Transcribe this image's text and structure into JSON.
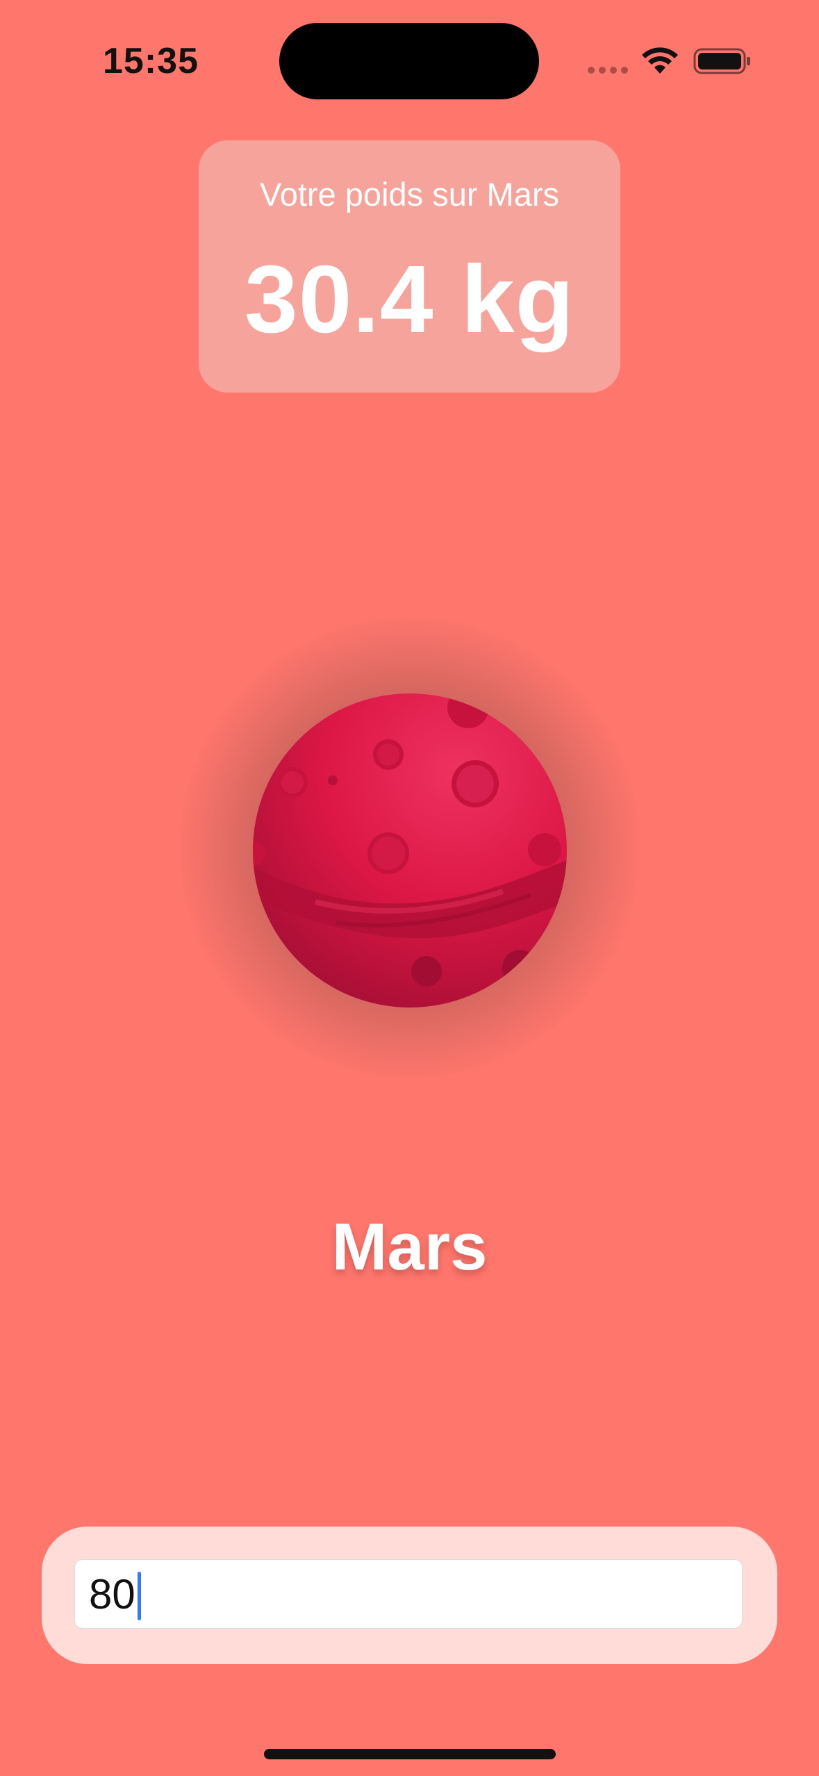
{
  "status_bar": {
    "time": "15:35",
    "icons": [
      "cellular-signal-icon",
      "wifi-icon",
      "battery-icon"
    ]
  },
  "weight_card": {
    "caption": "Votre poids sur Mars",
    "value": "30.4 kg"
  },
  "planet": {
    "name": "Mars",
    "image_icon": "mars-planet-icon"
  },
  "input": {
    "value": "80",
    "placeholder": ""
  },
  "colors": {
    "background": "#FF766C",
    "card": "#EEC8C4",
    "input_panel": "#FFDCD8",
    "planet": "#E0194A",
    "cursor": "#2F7BF5"
  }
}
